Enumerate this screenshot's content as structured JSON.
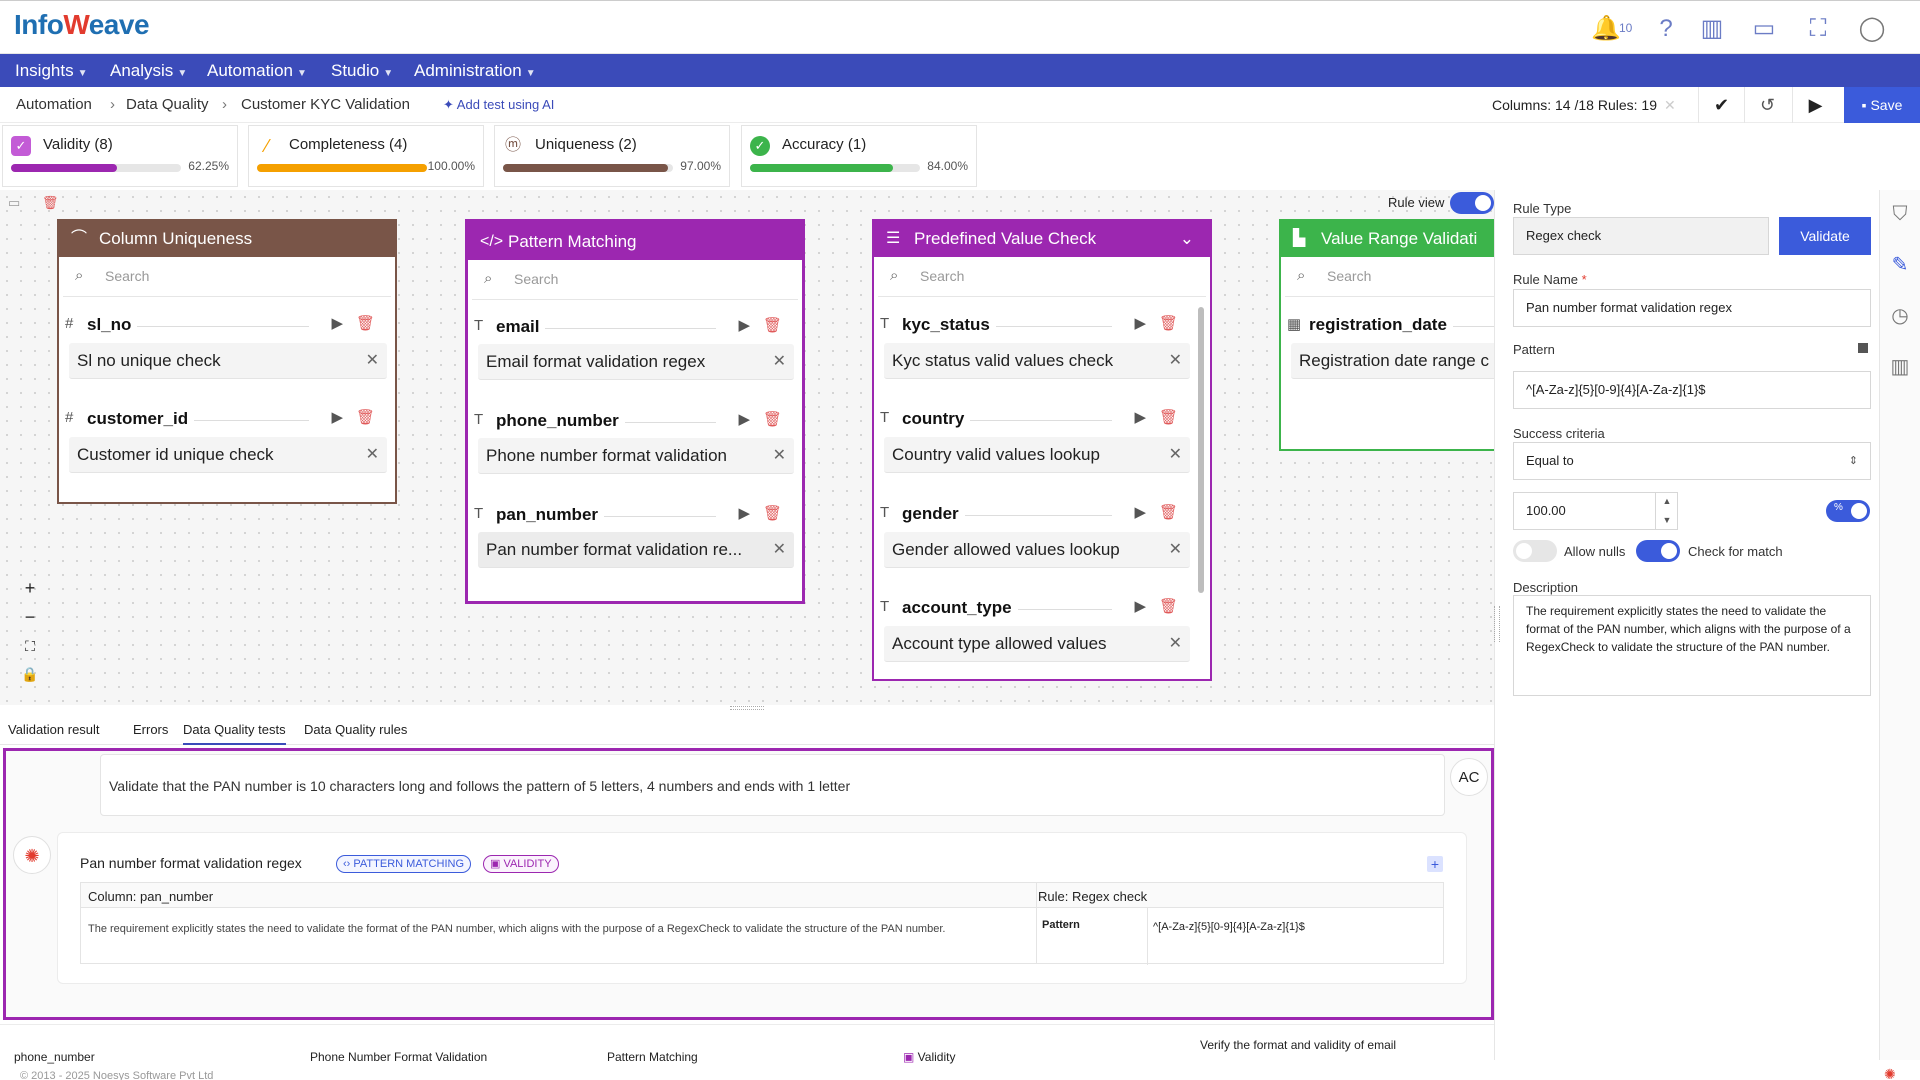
{
  "header": {
    "logo": {
      "part1": "Info",
      "part2": "W",
      "part3": "eave"
    },
    "notification_count": "10",
    "icons": [
      "bell-icon",
      "help-icon",
      "library-icon",
      "monitor-icon",
      "fullscreen-icon",
      "user-icon"
    ]
  },
  "menu": [
    {
      "label": "Insights"
    },
    {
      "label": "Analysis"
    },
    {
      "label": "Automation"
    },
    {
      "label": "Studio"
    },
    {
      "label": "Administration"
    }
  ],
  "breadcrumb": {
    "items": [
      "Automation",
      "Data Quality",
      "Customer KYC Validation"
    ],
    "add_ai": "Add test using AI"
  },
  "toolbar": {
    "columns_info": "Columns: 14 /18 Rules: 19",
    "save_label": "Save"
  },
  "metrics": [
    {
      "label": "Validity (8)",
      "percent": "62.25%",
      "value": 62.25,
      "color": "#9c27b0"
    },
    {
      "label": "Completeness (4)",
      "percent": "100.00%",
      "value": 100,
      "color": "#f5a000"
    },
    {
      "label": "Uniqueness (2)",
      "percent": "97.00%",
      "value": 97,
      "color": "#795548"
    },
    {
      "label": "Accuracy (1)",
      "percent": "84.00%",
      "value": 84,
      "color": "#3cb44b"
    }
  ],
  "canvas": {
    "rule_view_label": "Rule view",
    "search_placeholder": "Search",
    "cards": [
      {
        "title": "Column Uniqueness",
        "color": "#795548",
        "columns": [
          {
            "name": "sl_no",
            "rule": "Sl no unique check"
          },
          {
            "name": "customer_id",
            "rule": "Customer id unique check"
          }
        ]
      },
      {
        "title": "Pattern Matching",
        "color": "#9c27b0",
        "columns": [
          {
            "name": "email",
            "rule": "Email format validation regex"
          },
          {
            "name": "phone_number",
            "rule": "Phone number format validation"
          },
          {
            "name": "pan_number",
            "rule": "Pan number format validation re..."
          }
        ]
      },
      {
        "title": "Predefined Value Check",
        "color": "#9c27b0",
        "columns": [
          {
            "name": "kyc_status",
            "rule": "Kyc status valid values check"
          },
          {
            "name": "country",
            "rule": "Country valid values lookup"
          },
          {
            "name": "gender",
            "rule": "Gender allowed values lookup"
          },
          {
            "name": "account_type",
            "rule": "Account type allowed values"
          }
        ]
      },
      {
        "title": "Value Range Validati",
        "color": "#3cb44b",
        "columns": [
          {
            "name": "registration_date",
            "rule": "Registration date range c"
          }
        ]
      }
    ]
  },
  "tabs": [
    "Validation result",
    "Errors",
    "Data Quality tests",
    "Data Quality rules"
  ],
  "chat": {
    "user_question": "Validate that the PAN number is 10 characters long and follows the pattern of 5 letters, 4 numbers and ends with 1 letter",
    "user_initials": "AC",
    "response": {
      "rule_name": "Pan number format validation regex",
      "badge_pattern": "PATTERN MATCHING",
      "badge_validity": "VALIDITY",
      "column": "Column: pan_number",
      "rule": "Rule: Regex check",
      "description": "The requirement explicitly states the need to validate the format of the PAN number, which aligns with the purpose of a RegexCheck to validate the structure of the PAN number.",
      "pattern_label": "Pattern",
      "pattern_value": "^[A-Za-z]{5}[0-9]{4}[A-Za-z]{1}$"
    }
  },
  "bottom_list": {
    "row": [
      "phone_number",
      "Phone Number Format Validation",
      "Pattern Matching",
      "Validity",
      "Verify the format and validity of email"
    ],
    "copyright": "© 2013 - 2025 Noesys Software Pvt Ltd"
  },
  "rule_panel": {
    "rule_type_label": "Rule Type",
    "rule_type_value": "Regex check",
    "validate_label": "Validate",
    "rule_name_label": "Rule Name",
    "rule_name_value": "Pan number format validation regex",
    "pattern_label": "Pattern",
    "pattern_value": "^[A-Za-z]{5}[0-9]{4}[A-Za-z]{1}$",
    "success_label": "Success criteria",
    "success_value": "Equal to",
    "threshold_value": "100.00",
    "allow_nulls_label": "Allow nulls",
    "check_match_label": "Check for match",
    "description_label": "Description",
    "description_value": "The requirement explicitly states the need to validate the format of the PAN number, which aligns with the purpose of a RegexCheck to validate the structure of the PAN number."
  }
}
